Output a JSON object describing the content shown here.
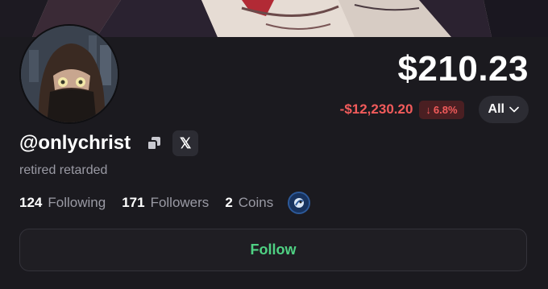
{
  "banner": {
    "image": "anime-character-banner"
  },
  "profile": {
    "avatar": "hijab-avatar-icon",
    "username": "@onlychrist",
    "bio": "retired retarded",
    "x_label": "𝕏"
  },
  "portfolio": {
    "balance": "$210.23",
    "change_amount": "-$12,230.20",
    "change_percent": "6.8%",
    "change_arrow": "↓",
    "range_selector": "All",
    "negative_color": "#f25b5b"
  },
  "stats": {
    "following_count": "124",
    "following_label": "Following",
    "followers_count": "171",
    "followers_label": "Followers",
    "coins_count": "2",
    "coins_label": "Coins"
  },
  "actions": {
    "follow_label": "Follow",
    "follow_color": "#4fd183"
  }
}
